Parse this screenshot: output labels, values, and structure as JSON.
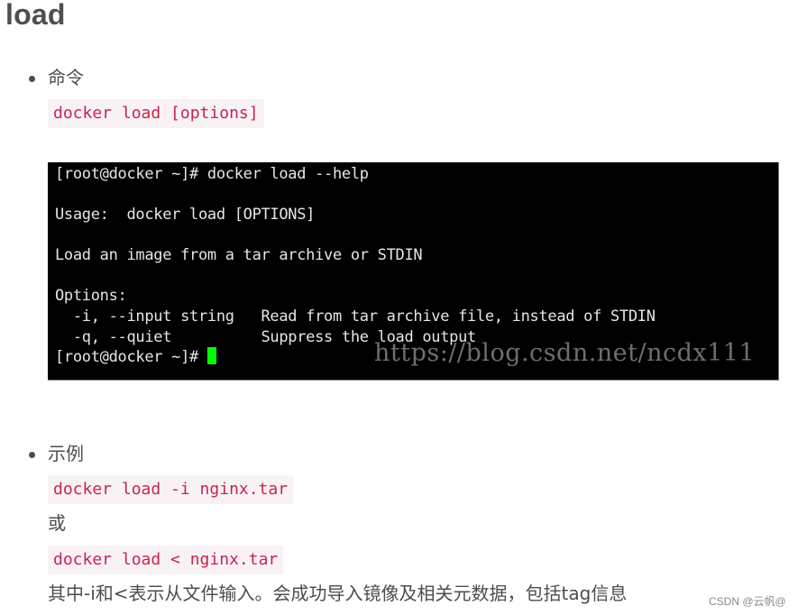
{
  "heading": "load",
  "sections": [
    {
      "label": "命令",
      "code": "docker load [options]"
    },
    {
      "label": "示例",
      "code_1": "docker load -i nginx.tar",
      "or_text": "或",
      "code_2": "docker load < nginx.tar",
      "description": "其中-i和<表示从文件输入。会成功导入镜像及相关元数据，包括tag信息"
    }
  ],
  "terminal": {
    "lines": [
      "[root@docker ~]# docker load --help",
      "",
      "Usage:  docker load [OPTIONS]",
      "",
      "Load an image from a tar archive or STDIN",
      "",
      "Options:",
      "  -i, --input string   Read from tar archive file, instead of STDIN",
      "  -q, --quiet          Suppress the load output",
      "[root@docker ~]# "
    ],
    "cursor_color": "#00ff00",
    "watermark": "https://blog.csdn.net/ncdx111"
  },
  "footer_watermark": "CSDN @云帆@",
  "colors": {
    "code_text": "#c7254e",
    "code_bg": "#f9f2f4",
    "terminal_bg": "#000000"
  }
}
